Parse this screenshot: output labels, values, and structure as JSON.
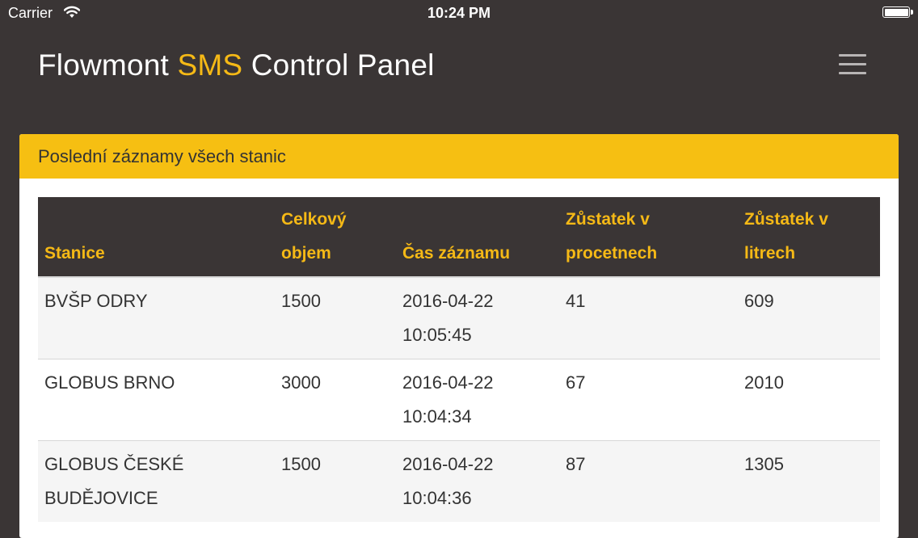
{
  "status_bar": {
    "carrier": "Carrier",
    "time": "10:24 PM"
  },
  "header": {
    "title_part1": "Flowmont ",
    "title_accent": "SMS",
    "title_part2": " Control Panel",
    "menu_icon": "hamburger-menu-icon"
  },
  "panel": {
    "heading": "Poslední záznamy všech stanic",
    "columns": [
      "Stanice",
      "Celkový objem",
      "Čas záznamu",
      "Zůstatek v procetnech",
      "Zůstatek v litrech"
    ],
    "rows": [
      [
        "BVŠP ODRY",
        "1500",
        "2016-04-22 10:05:45",
        "41",
        "609"
      ],
      [
        "GLOBUS BRNO",
        "3000",
        "2016-04-22 10:04:34",
        "67",
        "2010"
      ],
      [
        "GLOBUS ČESKÉ BUDĚJOVICE",
        "1500",
        "2016-04-22 10:04:36",
        "87",
        "1305"
      ]
    ]
  },
  "colors": {
    "accent": "#f5b916",
    "header_bg": "#3a3535",
    "panel_heading_bg": "#f6bf12"
  }
}
